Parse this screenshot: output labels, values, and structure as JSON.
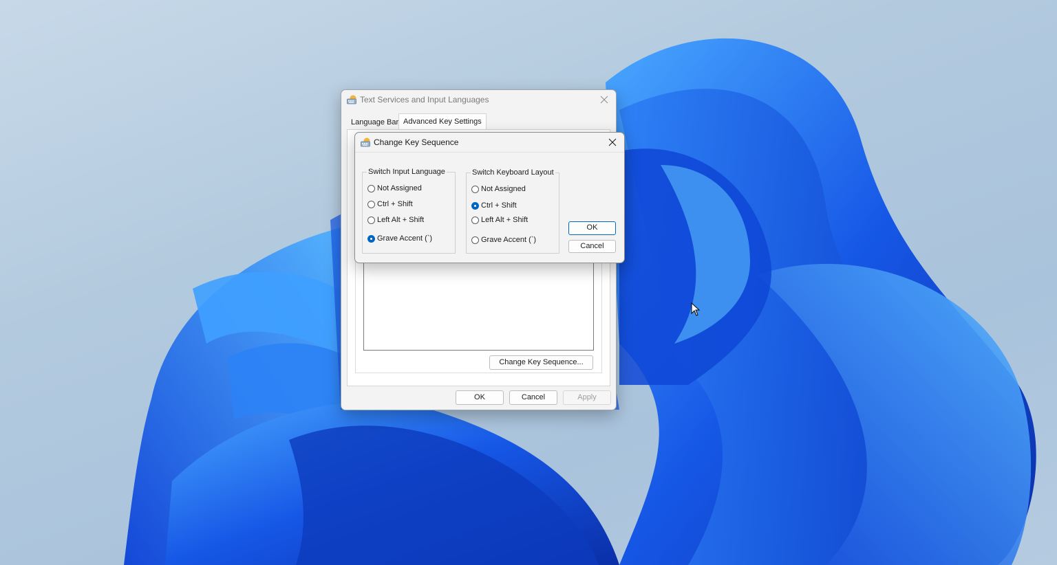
{
  "parent_dialog": {
    "title": "Text Services and Input Languages",
    "tabs": [
      {
        "label": "Language Bar",
        "active": false
      },
      {
        "label": "Advanced Key Settings",
        "active": true
      }
    ],
    "change_key_sequence_label": "Change Key Sequence...",
    "buttons": {
      "ok": "OK",
      "cancel": "Cancel",
      "apply": "Apply"
    }
  },
  "change_key_dialog": {
    "title": "Change Key Sequence",
    "switch_input_language": {
      "legend": "Switch Input Language",
      "options": [
        {
          "label": "Not Assigned",
          "selected": false
        },
        {
          "label": "Ctrl + Shift",
          "selected": false
        },
        {
          "label": "Left Alt + Shift",
          "selected": false
        },
        {
          "label": "Grave Accent (`)",
          "selected": true
        }
      ]
    },
    "switch_keyboard_layout": {
      "legend": "Switch Keyboard Layout",
      "options": [
        {
          "label": "Not Assigned",
          "selected": false
        },
        {
          "label": "Ctrl + Shift",
          "selected": true
        },
        {
          "label": "Left Alt + Shift",
          "selected": false
        },
        {
          "label": "Grave Accent (`)",
          "selected": false
        }
      ]
    },
    "buttons": {
      "ok": "OK",
      "cancel": "Cancel"
    }
  },
  "icons": {
    "keyboard_icon": "keyboard-icon",
    "close_icon": "close-icon",
    "cursor_icon": "mouse-pointer-icon"
  },
  "colors": {
    "accent": "#0067c0",
    "wallpaper_blue": "#1e5ff0"
  }
}
